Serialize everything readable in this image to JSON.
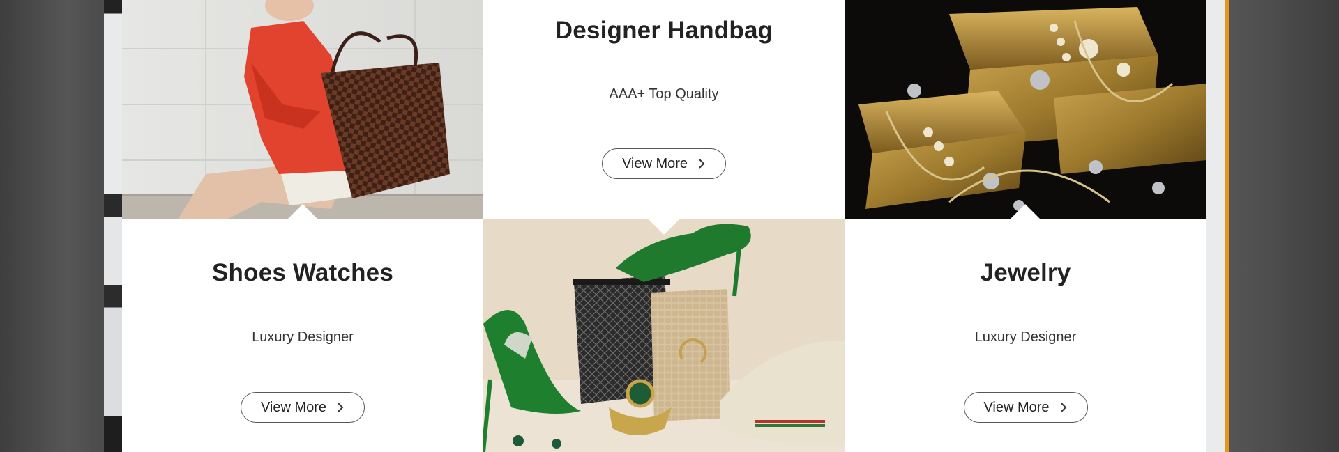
{
  "categories": [
    {
      "title": "Designer Handbag",
      "subtitle": "AAA+ Top Quality",
      "button_label": "View More"
    },
    {
      "title": "Shoes Watches",
      "subtitle": "Luxury Designer",
      "button_label": "View More"
    },
    {
      "title": "Jewelry",
      "subtitle": "Luxury Designer",
      "button_label": "View More"
    }
  ],
  "images": {
    "handbag": "woman-with-checkered-tote",
    "jewelry": "gold-bars-with-jewelry",
    "shoes": "green-heels-bags-sneakers"
  },
  "colors": {
    "accent": "#e8951e",
    "text_dark": "#222222",
    "card_bg": "#ffffff"
  }
}
